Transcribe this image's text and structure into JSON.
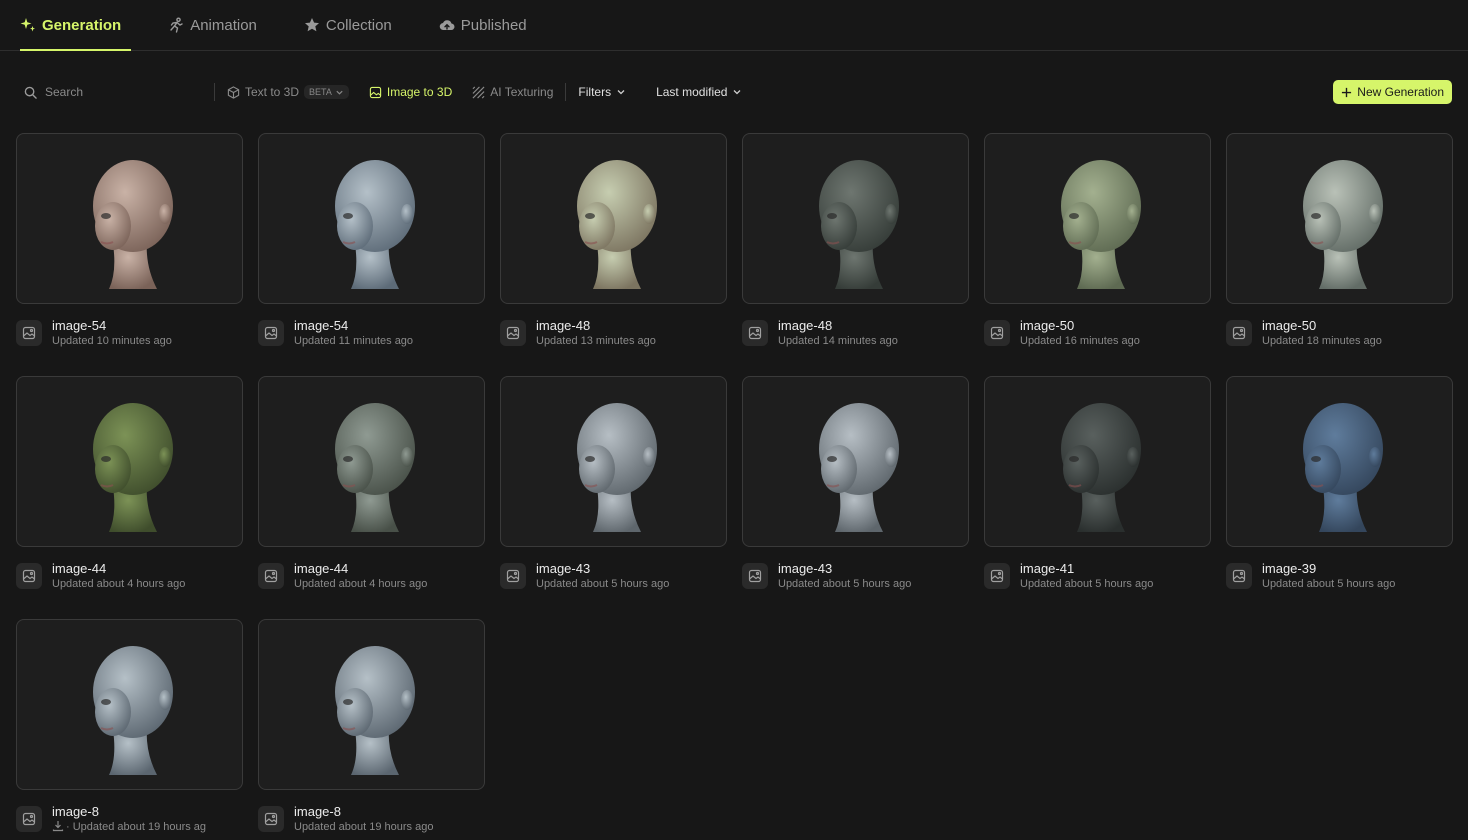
{
  "tabs": [
    {
      "label": "Generation",
      "icon": "sparkle-icon",
      "active": true
    },
    {
      "label": "Animation",
      "icon": "running-person-icon",
      "active": false
    },
    {
      "label": "Collection",
      "icon": "star-icon",
      "active": false
    },
    {
      "label": "Published",
      "icon": "cloud-upload-icon",
      "active": false
    }
  ],
  "toolbar": {
    "search_placeholder": "Search",
    "text_to_3d": "Text to 3D",
    "beta": "BETA",
    "image_to_3d": "Image to 3D",
    "ai_texturing": "AI Texturing",
    "filters": "Filters",
    "sort": "Last modified",
    "new_generation": "New Generation"
  },
  "colors": {
    "accent": "#d6f56a",
    "background": "#171717"
  },
  "items": [
    {
      "name": "image-54",
      "updated": "Updated 10 minutes ago",
      "skin": "#c9b2a6",
      "shade": "#7a6258"
    },
    {
      "name": "image-54",
      "updated": "Updated 11 minutes ago",
      "skin": "#b4c0c8",
      "shade": "#5d6b78"
    },
    {
      "name": "image-48",
      "updated": "Updated 13 minutes ago",
      "skin": "#c6cdb0",
      "shade": "#7c7460"
    },
    {
      "name": "image-48",
      "updated": "Updated 14 minutes ago",
      "skin": "#6e7670",
      "shade": "#353c38"
    },
    {
      "name": "image-50",
      "updated": "Updated 16 minutes ago",
      "skin": "#a3b08f",
      "shade": "#5e6a52"
    },
    {
      "name": "image-50",
      "updated": "Updated 18 minutes ago",
      "skin": "#b9c1b7",
      "shade": "#626c66"
    },
    {
      "name": "image-44",
      "updated": "Updated about 4 hours ago",
      "skin": "#7c9256",
      "shade": "#3f4d2c"
    },
    {
      "name": "image-44",
      "updated": "Updated about 4 hours ago",
      "skin": "#8f9a92",
      "shade": "#485048"
    },
    {
      "name": "image-43",
      "updated": "Updated about 5 hours ago",
      "skin": "#b6bec4",
      "shade": "#5e666c"
    },
    {
      "name": "image-43",
      "updated": "Updated about 5 hours ago",
      "skin": "#b6bec4",
      "shade": "#5e666c"
    },
    {
      "name": "image-41",
      "updated": "Updated about 5 hours ago",
      "skin": "#59605e",
      "shade": "#2a2f2e"
    },
    {
      "name": "image-39",
      "updated": "Updated about 5 hours ago",
      "skin": "#5f7c9c",
      "shade": "#34465c"
    },
    {
      "name": "image-8",
      "updated": "· Updated about 19 hours ag",
      "skin": "#b5c0c7",
      "shade": "#5b6670",
      "download": true
    },
    {
      "name": "image-8",
      "updated": "Updated about 19 hours ago",
      "skin": "#b5c0c7",
      "shade": "#5b6670"
    }
  ]
}
